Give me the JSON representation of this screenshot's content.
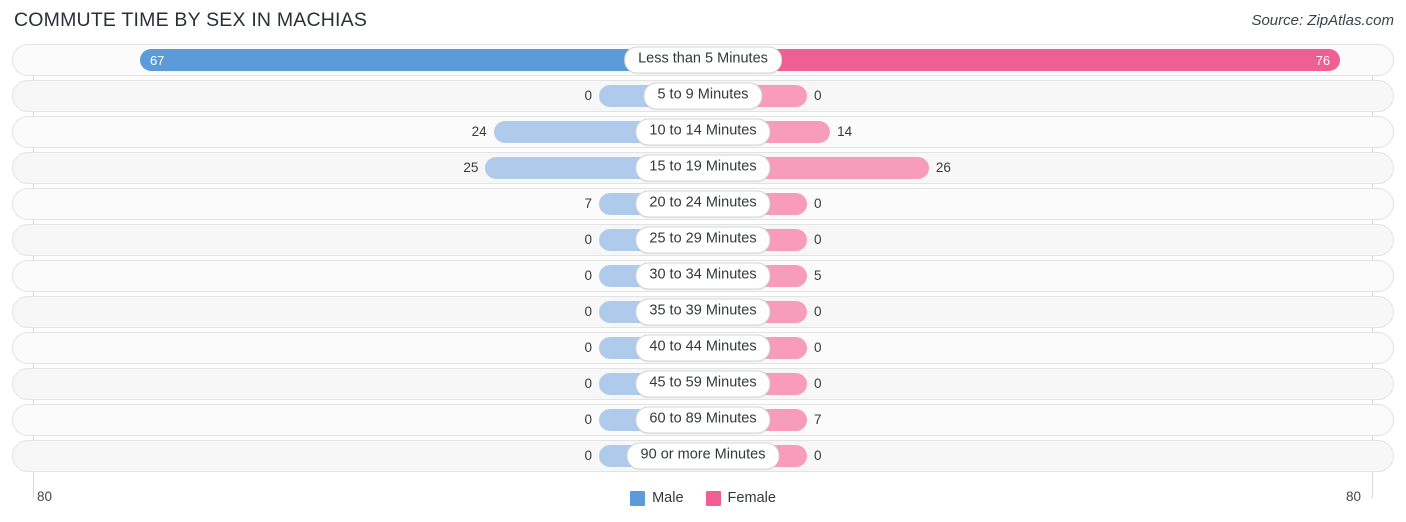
{
  "header": {
    "title": "COMMUTE TIME BY SEX IN MACHIAS",
    "source": "Source: ZipAtlas.com"
  },
  "axis": {
    "left_label": "80",
    "right_label": "80",
    "max": 80
  },
  "legend": {
    "items": [
      {
        "label": "Male",
        "color": "#5b9bd9",
        "icon": "male-swatch-icon"
      },
      {
        "label": "Female",
        "color": "#ef5f92",
        "icon": "female-swatch-icon"
      }
    ]
  },
  "colors": {
    "male_strong": "#5b9bd9",
    "male_pastel": "#aecbec",
    "female_strong": "#ef5f92",
    "female_pastel": "#f79cbb",
    "track": "#fbfbfb",
    "track_alt": "#f7f7f7",
    "border": "#e3e3e3"
  },
  "chart_data": {
    "type": "bar",
    "orientation": "horizontal-diverging",
    "title": "COMMUTE TIME BY SEX IN MACHIAS",
    "xlabel": "",
    "ylabel": "",
    "xlim": [
      80,
      80
    ],
    "grid": true,
    "legend_position": "bottom-center",
    "categories": [
      "Less than 5 Minutes",
      "5 to 9 Minutes",
      "10 to 14 Minutes",
      "15 to 19 Minutes",
      "20 to 24 Minutes",
      "25 to 29 Minutes",
      "30 to 34 Minutes",
      "35 to 39 Minutes",
      "40 to 44 Minutes",
      "45 to 59 Minutes",
      "60 to 89 Minutes",
      "90 or more Minutes"
    ],
    "series": [
      {
        "name": "Male",
        "values": [
          67,
          0,
          24,
          25,
          7,
          0,
          0,
          0,
          0,
          0,
          0,
          0
        ]
      },
      {
        "name": "Female",
        "values": [
          76,
          0,
          14,
          26,
          0,
          0,
          5,
          0,
          0,
          0,
          7,
          0
        ]
      }
    ]
  },
  "rows": [
    {
      "category": "Less than 5 Minutes",
      "male": "67",
      "female": "76"
    },
    {
      "category": "5 to 9 Minutes",
      "male": "0",
      "female": "0"
    },
    {
      "category": "10 to 14 Minutes",
      "male": "24",
      "female": "14"
    },
    {
      "category": "15 to 19 Minutes",
      "male": "25",
      "female": "26"
    },
    {
      "category": "20 to 24 Minutes",
      "male": "7",
      "female": "0"
    },
    {
      "category": "25 to 29 Minutes",
      "male": "0",
      "female": "0"
    },
    {
      "category": "30 to 34 Minutes",
      "male": "0",
      "female": "5"
    },
    {
      "category": "35 to 39 Minutes",
      "male": "0",
      "female": "0"
    },
    {
      "category": "40 to 44 Minutes",
      "male": "0",
      "female": "0"
    },
    {
      "category": "45 to 59 Minutes",
      "male": "0",
      "female": "0"
    },
    {
      "category": "60 to 89 Minutes",
      "male": "0",
      "female": "7"
    },
    {
      "category": "90 or more Minutes",
      "male": "0",
      "female": "0"
    }
  ]
}
